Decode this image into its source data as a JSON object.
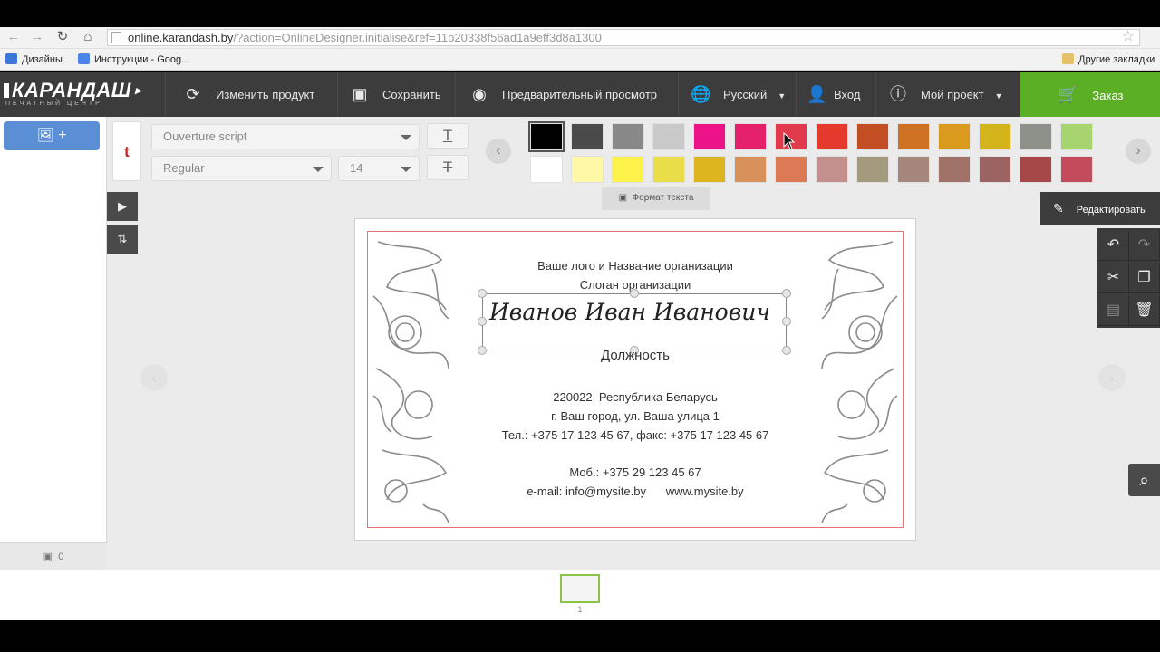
{
  "browser": {
    "url_host": "online.karandash.by",
    "url_rest": "/?action=OnlineDesigner.initialise&ref=11b20338f56ad1a9eff3d8a1300",
    "bookmarks": [
      "Дизайны",
      "Инструкции - Goog..."
    ],
    "bookmarks_right": "Другие закладки"
  },
  "topbar": {
    "logo": "КАРАНДАШ",
    "logo_sub": "ПЕЧАТНЫЙ ЦЕНТР",
    "change_product": "Изменить продукт",
    "save": "Сохранить",
    "preview": "Предварительный просмотр",
    "language": "Русский",
    "login": "Вход",
    "my_project": "Мой проект",
    "order": "Заказ"
  },
  "text_toolbar": {
    "font": "Ouverture script",
    "style": "Regular",
    "size": "14",
    "tooltip": "Формат текста",
    "swatches_row1": [
      "#000000",
      "#4a4a4a",
      "#888888",
      "#c9c9c9",
      "#ec1287",
      "#e5206b",
      "#e23a4d",
      "#e6392e",
      "#c44e24",
      "#cf7122",
      "#d99a1e",
      "#d3b51b",
      "#8d918a",
      "#a8d470"
    ],
    "swatches_row2": [
      "#ffffff",
      "#fff8a6",
      "#fdf34a",
      "#e9de4a",
      "#dcb51f",
      "#d9915c",
      "#dc7a56",
      "#c4908e",
      "#a49b7e",
      "#a4877a",
      "#a07268",
      "#9b6462",
      "#a64848",
      "#c24b5c"
    ]
  },
  "left_panel": {
    "add_image": "+",
    "image_count": "0"
  },
  "right_tools": {
    "edit": "Редактировать"
  },
  "card": {
    "line1": "Ваше лого и Название организации",
    "line2": "Слоган организации",
    "name": "Иванов Иван Иванович",
    "position": "Должность",
    "addr1": "220022, Республика Беларусь",
    "addr2": "г. Ваш город, ул. Ваша улица 1",
    "phone": "Тел.: +375 17 123 45 67, факс: +375 17 123 45 67",
    "mobile": "Моб.: +375 29 123 45 67",
    "email": "e-mail: info@mysite.by",
    "site": "www.mysite.by"
  },
  "pages": {
    "current": "1"
  }
}
